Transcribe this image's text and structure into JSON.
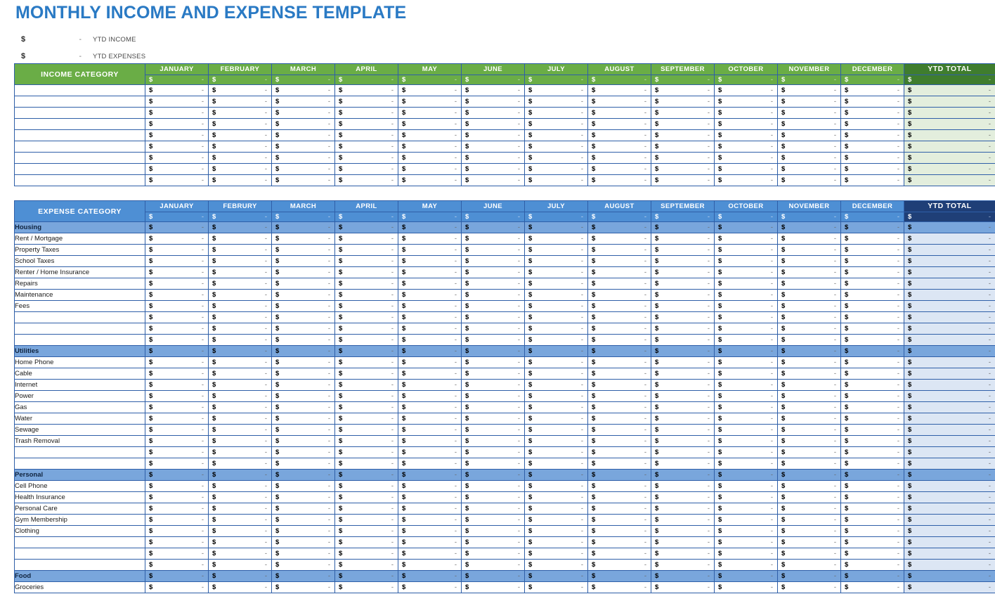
{
  "page": {
    "title": "MONTHLY INCOME AND EXPENSE TEMPLATE",
    "title_color": "#2a7ac4"
  },
  "summary": {
    "rows": [
      {
        "symbol": "$",
        "value": "-",
        "label": "YTD INCOME"
      },
      {
        "symbol": "$",
        "value": "-",
        "label": "YTD EXPENSES"
      }
    ]
  },
  "income_table": {
    "category_header": "INCOME CATEGORY",
    "months": [
      "JANUARY",
      "FEBRUARY",
      "MARCH",
      "APRIL",
      "MAY",
      "JUNE",
      "JULY",
      "AUGUST",
      "SEPTEMBER",
      "OCTOBER",
      "NOVEMBER",
      "DECEMBER"
    ],
    "ytd_header": "YTD TOTAL",
    "header_color": "#6aad46",
    "ytd_header_color": "#3f7d2e",
    "ytd_cell_color": "#e3eedd",
    "currency_symbol": "$",
    "empty_value": "-",
    "totals_row": {
      "months": [
        "-",
        "-",
        "-",
        "-",
        "-",
        "-",
        "-",
        "-",
        "-",
        "-",
        "-",
        "-"
      ],
      "ytd": "-"
    },
    "rows": [
      {
        "label": "",
        "months": [
          "-",
          "-",
          "-",
          "-",
          "-",
          "-",
          "-",
          "-",
          "-",
          "-",
          "-",
          "-"
        ],
        "ytd": "-"
      },
      {
        "label": "",
        "months": [
          "-",
          "-",
          "-",
          "-",
          "-",
          "-",
          "-",
          "-",
          "-",
          "-",
          "-",
          "-"
        ],
        "ytd": "-"
      },
      {
        "label": "",
        "months": [
          "-",
          "-",
          "-",
          "-",
          "-",
          "-",
          "-",
          "-",
          "-",
          "-",
          "-",
          "-"
        ],
        "ytd": "-"
      },
      {
        "label": "",
        "months": [
          "-",
          "-",
          "-",
          "-",
          "-",
          "-",
          "-",
          "-",
          "-",
          "-",
          "-",
          "-"
        ],
        "ytd": "-"
      },
      {
        "label": "",
        "months": [
          "-",
          "-",
          "-",
          "-",
          "-",
          "-",
          "-",
          "-",
          "-",
          "-",
          "-",
          "-"
        ],
        "ytd": "-"
      },
      {
        "label": "",
        "months": [
          "-",
          "-",
          "-",
          "-",
          "-",
          "-",
          "-",
          "-",
          "-",
          "-",
          "-",
          "-"
        ],
        "ytd": "-"
      },
      {
        "label": "",
        "months": [
          "-",
          "-",
          "-",
          "-",
          "-",
          "-",
          "-",
          "-",
          "-",
          "-",
          "-",
          "-"
        ],
        "ytd": "-"
      },
      {
        "label": "",
        "months": [
          "-",
          "-",
          "-",
          "-",
          "-",
          "-",
          "-",
          "-",
          "-",
          "-",
          "-",
          "-"
        ],
        "ytd": "-"
      },
      {
        "label": "",
        "months": [
          "-",
          "-",
          "-",
          "-",
          "-",
          "-",
          "-",
          "-",
          "-",
          "-",
          "-",
          "-"
        ],
        "ytd": "-"
      }
    ]
  },
  "expense_table": {
    "category_header": "EXPENSE CATEGORY",
    "months": [
      "JANUARY",
      "FEBRURY",
      "MARCH",
      "APRIL",
      "MAY",
      "JUNE",
      "JULY",
      "AUGUST",
      "SEPTEMBER",
      "OCTOBER",
      "NOVEMBER",
      "DECEMBER"
    ],
    "ytd_header": "YTD TOTAL",
    "header_color": "#4e8fd4",
    "ytd_header_color": "#1f3f77",
    "group_row_color": "#79a6dc",
    "ytd_cell_color": "#dce6f4",
    "currency_symbol": "$",
    "empty_value": "-",
    "totals_row": {
      "months": [
        "-",
        "-",
        "-",
        "-",
        "-",
        "-",
        "-",
        "-",
        "-",
        "-",
        "-",
        "-"
      ],
      "ytd": "-"
    },
    "rows": [
      {
        "label": "Housing",
        "type": "group",
        "months": [
          "-",
          "-",
          "-",
          "-",
          "-",
          "-",
          "-",
          "-",
          "-",
          "-",
          "-",
          "-"
        ],
        "ytd": "-"
      },
      {
        "label": "Rent / Mortgage",
        "type": "item",
        "months": [
          "-",
          "-",
          "-",
          "-",
          "-",
          "-",
          "-",
          "-",
          "-",
          "-",
          "-",
          "-"
        ],
        "ytd": "-"
      },
      {
        "label": "Property Taxes",
        "type": "item",
        "months": [
          "-",
          "-",
          "-",
          "-",
          "-",
          "-",
          "-",
          "-",
          "-",
          "-",
          "-",
          "-"
        ],
        "ytd": "-"
      },
      {
        "label": "School Taxes",
        "type": "item",
        "months": [
          "-",
          "-",
          "-",
          "-",
          "-",
          "-",
          "-",
          "-",
          "-",
          "-",
          "-",
          "-"
        ],
        "ytd": "-"
      },
      {
        "label": "Renter / Home Insurance",
        "type": "item",
        "months": [
          "-",
          "-",
          "-",
          "-",
          "-",
          "-",
          "-",
          "-",
          "-",
          "-",
          "-",
          "-"
        ],
        "ytd": "-"
      },
      {
        "label": "Repairs",
        "type": "item",
        "months": [
          "-",
          "-",
          "-",
          "-",
          "-",
          "-",
          "-",
          "-",
          "-",
          "-",
          "-",
          "-"
        ],
        "ytd": "-"
      },
      {
        "label": "Maintenance",
        "type": "item",
        "months": [
          "-",
          "-",
          "-",
          "-",
          "-",
          "-",
          "-",
          "-",
          "-",
          "-",
          "-",
          "-"
        ],
        "ytd": "-"
      },
      {
        "label": "Fees",
        "type": "item",
        "months": [
          "-",
          "-",
          "-",
          "-",
          "-",
          "-",
          "-",
          "-",
          "-",
          "-",
          "-",
          "-"
        ],
        "ytd": "-"
      },
      {
        "label": "",
        "type": "item",
        "months": [
          "-",
          "-",
          "-",
          "-",
          "-",
          "-",
          "-",
          "-",
          "-",
          "-",
          "-",
          "-"
        ],
        "ytd": "-"
      },
      {
        "label": "",
        "type": "item",
        "months": [
          "-",
          "-",
          "-",
          "-",
          "-",
          "-",
          "-",
          "-",
          "-",
          "-",
          "-",
          "-"
        ],
        "ytd": "-"
      },
      {
        "label": "",
        "type": "item",
        "months": [
          "-",
          "-",
          "-",
          "-",
          "-",
          "-",
          "-",
          "-",
          "-",
          "-",
          "-",
          "-"
        ],
        "ytd": "-"
      },
      {
        "label": "Utilities",
        "type": "group",
        "months": [
          "-",
          "-",
          "-",
          "-",
          "-",
          "-",
          "-",
          "-",
          "-",
          "-",
          "-",
          "-"
        ],
        "ytd": "-"
      },
      {
        "label": "Home Phone",
        "type": "item",
        "months": [
          "-",
          "-",
          "-",
          "-",
          "-",
          "-",
          "-",
          "-",
          "-",
          "-",
          "-",
          "-"
        ],
        "ytd": "-"
      },
      {
        "label": "Cable",
        "type": "item",
        "months": [
          "-",
          "-",
          "-",
          "-",
          "-",
          "-",
          "-",
          "-",
          "-",
          "-",
          "-",
          "-"
        ],
        "ytd": "-"
      },
      {
        "label": "Internet",
        "type": "item",
        "months": [
          "-",
          "-",
          "-",
          "-",
          "-",
          "-",
          "-",
          "-",
          "-",
          "-",
          "-",
          "-"
        ],
        "ytd": "-"
      },
      {
        "label": "Power",
        "type": "item",
        "months": [
          "-",
          "-",
          "-",
          "-",
          "-",
          "-",
          "-",
          "-",
          "-",
          "-",
          "-",
          "-"
        ],
        "ytd": "-"
      },
      {
        "label": "Gas",
        "type": "item",
        "months": [
          "-",
          "-",
          "-",
          "-",
          "-",
          "-",
          "-",
          "-",
          "-",
          "-",
          "-",
          "-"
        ],
        "ytd": "-"
      },
      {
        "label": "Water",
        "type": "item",
        "months": [
          "-",
          "-",
          "-",
          "-",
          "-",
          "-",
          "-",
          "-",
          "-",
          "-",
          "-",
          "-"
        ],
        "ytd": "-"
      },
      {
        "label": "Sewage",
        "type": "item",
        "months": [
          "-",
          "-",
          "-",
          "-",
          "-",
          "-",
          "-",
          "-",
          "-",
          "-",
          "-",
          "-"
        ],
        "ytd": "-"
      },
      {
        "label": "Trash Removal",
        "type": "item",
        "months": [
          "-",
          "-",
          "-",
          "-",
          "-",
          "-",
          "-",
          "-",
          "-",
          "-",
          "-",
          "-"
        ],
        "ytd": "-"
      },
      {
        "label": "",
        "type": "item",
        "months": [
          "-",
          "-",
          "-",
          "-",
          "-",
          "-",
          "-",
          "-",
          "-",
          "-",
          "-",
          "-"
        ],
        "ytd": "-"
      },
      {
        "label": "",
        "type": "item",
        "months": [
          "-",
          "-",
          "-",
          "-",
          "-",
          "-",
          "-",
          "-",
          "-",
          "-",
          "-",
          "-"
        ],
        "ytd": "-"
      },
      {
        "label": "Personal",
        "type": "group",
        "months": [
          "-",
          "-",
          "-",
          "-",
          "-",
          "-",
          "-",
          "-",
          "-",
          "-",
          "-",
          "-"
        ],
        "ytd": "-"
      },
      {
        "label": "Cell Phone",
        "type": "item",
        "months": [
          "-",
          "-",
          "-",
          "-",
          "-",
          "-",
          "-",
          "-",
          "-",
          "-",
          "-",
          "-"
        ],
        "ytd": "-"
      },
      {
        "label": "Health Insurance",
        "type": "item",
        "months": [
          "-",
          "-",
          "-",
          "-",
          "-",
          "-",
          "-",
          "-",
          "-",
          "-",
          "-",
          "-"
        ],
        "ytd": "-"
      },
      {
        "label": "Personal Care",
        "type": "item",
        "months": [
          "-",
          "-",
          "-",
          "-",
          "-",
          "-",
          "-",
          "-",
          "-",
          "-",
          "-",
          "-"
        ],
        "ytd": "-"
      },
      {
        "label": "Gym Membership",
        "type": "item",
        "months": [
          "-",
          "-",
          "-",
          "-",
          "-",
          "-",
          "-",
          "-",
          "-",
          "-",
          "-",
          "-"
        ],
        "ytd": "-"
      },
      {
        "label": "Clothing",
        "type": "item",
        "months": [
          "-",
          "-",
          "-",
          "-",
          "-",
          "-",
          "-",
          "-",
          "-",
          "-",
          "-",
          "-"
        ],
        "ytd": "-"
      },
      {
        "label": "",
        "type": "item",
        "months": [
          "-",
          "-",
          "-",
          "-",
          "-",
          "-",
          "-",
          "-",
          "-",
          "-",
          "-",
          "-"
        ],
        "ytd": "-"
      },
      {
        "label": "",
        "type": "item",
        "months": [
          "-",
          "-",
          "-",
          "-",
          "-",
          "-",
          "-",
          "-",
          "-",
          "-",
          "-",
          "-"
        ],
        "ytd": "-"
      },
      {
        "label": "",
        "type": "item",
        "months": [
          "-",
          "-",
          "-",
          "-",
          "-",
          "-",
          "-",
          "-",
          "-",
          "-",
          "-",
          "-"
        ],
        "ytd": "-"
      },
      {
        "label": "Food",
        "type": "group",
        "months": [
          "-",
          "-",
          "-",
          "-",
          "-",
          "-",
          "-",
          "-",
          "-",
          "-",
          "-",
          "-"
        ],
        "ytd": "-"
      },
      {
        "label": "Groceries",
        "type": "item",
        "months": [
          "-",
          "-",
          "-",
          "-",
          "-",
          "-",
          "-",
          "-",
          "-",
          "-",
          "-",
          "-"
        ],
        "ytd": "-"
      }
    ]
  }
}
